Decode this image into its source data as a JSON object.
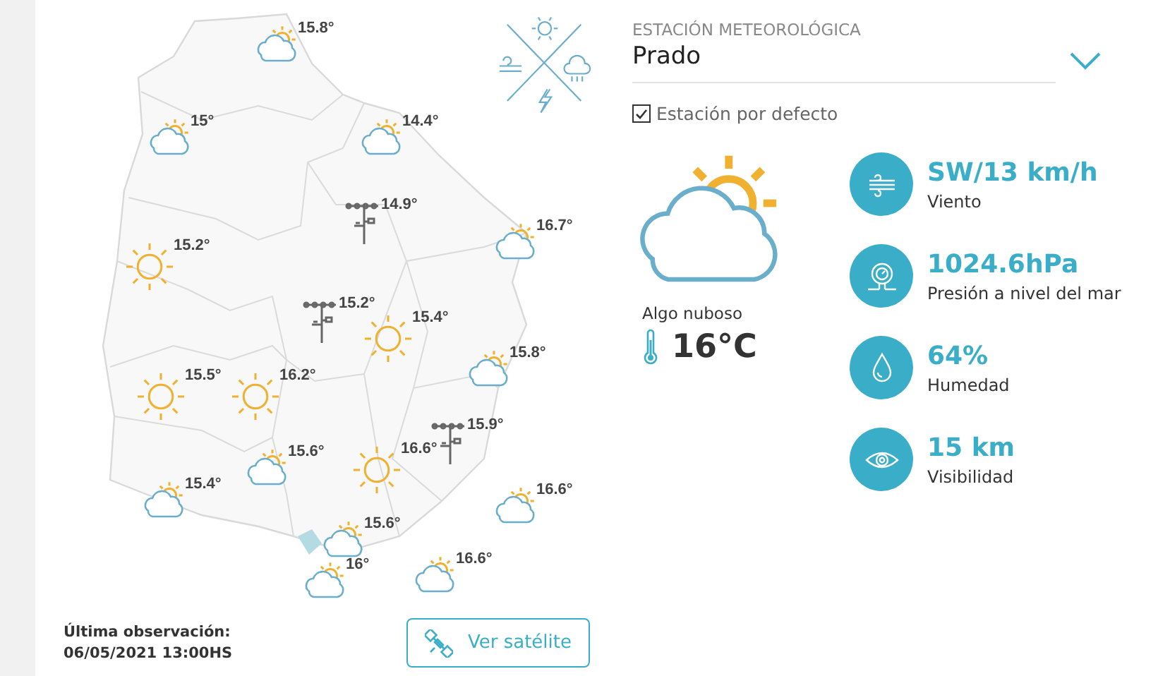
{
  "map": {
    "markers": [
      {
        "kind": "partly",
        "temp": "15.8°"
      },
      {
        "kind": "partly",
        "temp": "15°"
      },
      {
        "kind": "partly",
        "temp": "14.4°"
      },
      {
        "kind": "station",
        "temp": "14.9°"
      },
      {
        "kind": "partly",
        "temp": "16.7°"
      },
      {
        "kind": "sun",
        "temp": "15.2°"
      },
      {
        "kind": "station",
        "temp": "15.2°"
      },
      {
        "kind": "sun",
        "temp": "15.4°"
      },
      {
        "kind": "partly",
        "temp": "15.8°"
      },
      {
        "kind": "sun",
        "temp": "15.5°"
      },
      {
        "kind": "sun",
        "temp": "16.2°"
      },
      {
        "kind": "station",
        "temp": "15.9°"
      },
      {
        "kind": "sun",
        "temp": "16.6°"
      },
      {
        "kind": "partly",
        "temp": "15.6°"
      },
      {
        "kind": "partly",
        "temp": "15.4°"
      },
      {
        "kind": "partly",
        "temp": "16.6°"
      },
      {
        "kind": "partly",
        "temp": "15.6°"
      },
      {
        "kind": "partly",
        "temp": "16°"
      },
      {
        "kind": "partly",
        "temp": "16.6°"
      }
    ]
  },
  "last_observation": {
    "label": "Última observación:",
    "value": "06/05/2021 13:00HS"
  },
  "satellite_button": "Ver satélite",
  "station": {
    "label": "ESTACIÓN METEOROLÓGICA",
    "value": "Prado"
  },
  "default_station": {
    "label": "Estación por defecto",
    "checked": true
  },
  "current": {
    "kind": "partly",
    "description": "Algo nuboso",
    "temperature": "16°C"
  },
  "stats": [
    {
      "kind": "wind",
      "value": "SW/13 km/h",
      "label": "Viento"
    },
    {
      "kind": "pressure",
      "value": "1024.6hPa",
      "label": "Presión a nivel del mar"
    },
    {
      "kind": "humidity",
      "value": "64%",
      "label": "Humedad"
    },
    {
      "kind": "visibility",
      "value": "15 km",
      "label": "Visibilidad"
    }
  ]
}
